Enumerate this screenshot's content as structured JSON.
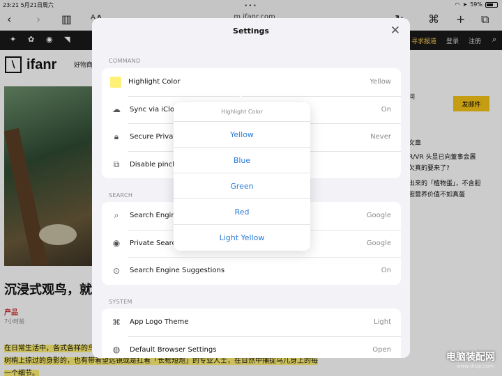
{
  "status": {
    "time": "23:21",
    "date": "5月21日周六",
    "battery": "59%"
  },
  "toolbar": {
    "url": "m.ifanr.com"
  },
  "site": {
    "logo_mark": "\\",
    "logo_text": "ifanr",
    "nav_link": "好物商",
    "links": [
      "寻求报道",
      "登录",
      "注册"
    ],
    "headline": "沉浸式观鸟，就",
    "category": "产品",
    "time_ago": "7小时前",
    "paragraph_line1": "在日常生活中，各式各样的鸟",
    "paragraph_line2": "树梢上掠过的身影的，也有带着望远镜或是扛着「长枪短炮」的专业人士，在目然中捕捉鸟儿身上的每",
    "paragraph_line3": "一个细节。",
    "mail_button": "发邮件",
    "right_lines": [
      "间",
      "文章",
      "R/VR 头显已向董事会展",
      "欠真的要来了?",
      "出来的「植物蛋」，不含胆",
      "胆营养价值不如真蛋"
    ]
  },
  "settings": {
    "title": "Settings",
    "sections": {
      "command": "COMMAND",
      "search": "SEARCH",
      "system": "SYSTEM"
    },
    "command_rows": [
      {
        "label": "Highlight Color",
        "value": "Yellow"
      },
      {
        "label": "Sync via iClou",
        "value": "On"
      },
      {
        "label": "Secure Privat",
        "value": "Never"
      },
      {
        "label": "Disable pinch",
        "value": ""
      }
    ],
    "search_rows": [
      {
        "label": "Search Engine",
        "value": "Google"
      },
      {
        "label": "Private Searc",
        "value": "Google"
      },
      {
        "label": "Search Engine Suggestions",
        "value": "On"
      }
    ],
    "system_rows": [
      {
        "label": "App Logo Theme",
        "value": "Light"
      },
      {
        "label": "Default Browser Settings",
        "value": "Open"
      }
    ]
  },
  "popup": {
    "title": "Highlight Color",
    "options": [
      "Yellow",
      "Blue",
      "Green",
      "Red",
      "Light Yellow"
    ]
  },
  "watermark": {
    "title": "电脑装配网",
    "url": "www.dnzp.com"
  }
}
